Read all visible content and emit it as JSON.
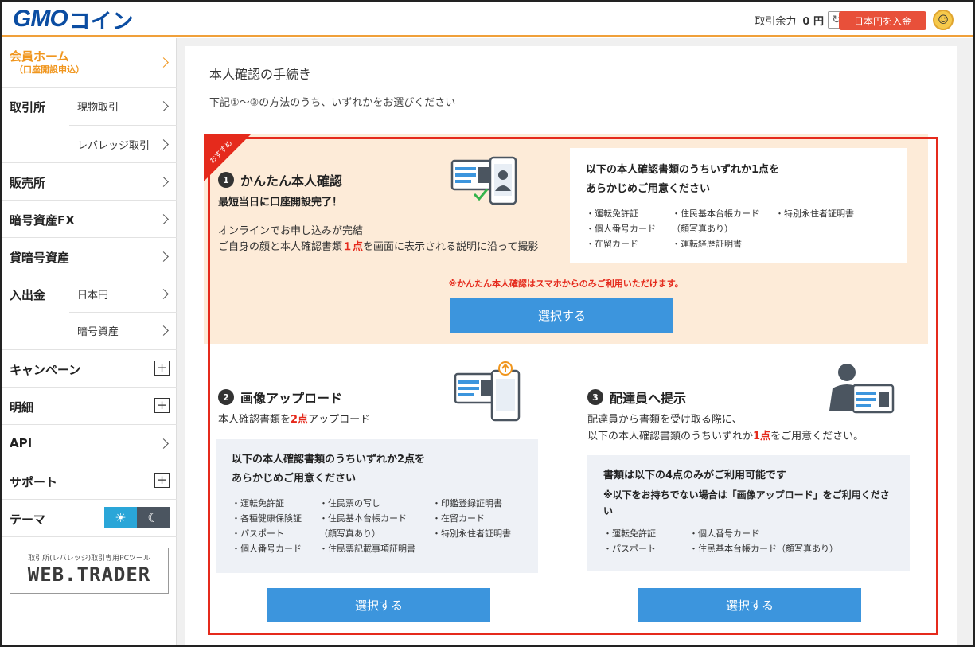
{
  "header": {
    "logo_gmo": "GMO",
    "logo_coin": "コイン",
    "balance_label": "取引余力",
    "balance_value": "0 円",
    "deposit_label": "日本円を入金"
  },
  "sidebar": {
    "home_label": "会員ホーム",
    "home_sub": "（口座開設申込）",
    "exchange_label": "取引所",
    "exchange_items": [
      "現物取引",
      "レバレッジ取引"
    ],
    "dealer_label": "販売所",
    "fx_label": "暗号資産FX",
    "lending_label": "貸暗号資産",
    "inout_label": "入出金",
    "inout_items": [
      "日本円",
      "暗号資産"
    ],
    "campaign_label": "キャンペーン",
    "detail_label": "明細",
    "api_label": "API",
    "support_label": "サポート",
    "theme_label": "テーマ",
    "webtrader_caption": "取引所(レバレッジ)取引専用PCツール",
    "webtrader_logo": "WEB.TRADER"
  },
  "main": {
    "title": "本人確認の手続き",
    "desc": "下記①～③の方法のうち、いずれかをお選びください",
    "select_label": "選択する"
  },
  "card1": {
    "ribbon": "おすすめ",
    "num": "1",
    "title": "かんたん本人確認",
    "subtitle": "最短当日に口座開設完了！",
    "desc_line1": "オンラインでお申し込みが完結",
    "desc_line2_pre": "ご自身の顔と本人確認書類",
    "desc_line2_em": "１点",
    "desc_line2_post": "を画面に表示される説明に沿って撮影",
    "docs_head_1": "以下の本人確認書類のうちいずれか1点を",
    "docs_head_2": "あらかじめご用意ください",
    "docs": [
      "・運転免許証",
      "・住民基本台帳カード",
      "・特別永住者証明書",
      "・個人番号カード",
      "（顔写真あり）",
      "",
      "・在留カード",
      "・運転経歴証明書",
      ""
    ],
    "note": "※かんたん本人確認はスマホからのみご利用いただけます。"
  },
  "card2": {
    "num": "2",
    "title": "画像アップロード",
    "desc_pre": "本人確認書類を",
    "desc_em": "2点",
    "desc_post": "アップロード",
    "docs_head_1": "以下の本人確認書類のうちいずれか2点を",
    "docs_head_2": "あらかじめご用意ください",
    "docs": [
      "・運転免許証",
      "・住民票の写し",
      "・印鑑登録証明書",
      "・各種健康保険証",
      "・住民基本台帳カード",
      "・在留カード",
      "・パスポート",
      "（顔写真あり）",
      "・特別永住者証明書",
      "・個人番号カード",
      "・住民票記載事項証明書",
      ""
    ]
  },
  "card3": {
    "num": "3",
    "title": "配達員へ提示",
    "desc_line1": "配達員から書類を受け取る際に、",
    "desc_line2_pre": "以下の本人確認書類のうちいずれか",
    "desc_line2_em": "1点",
    "desc_line2_post": "をご用意ください。",
    "docs_head_1": "書類は以下の4点のみがご利用可能です",
    "docs_note": "※以下をお持ちでない場合は「画像アップロード」をご利用くださ",
    "docs_note_2": "い",
    "docs": [
      "・運転免許証",
      "・個人番号カード",
      "・パスポート",
      "・住民基本台帳カード（顔写真あり）"
    ]
  }
}
